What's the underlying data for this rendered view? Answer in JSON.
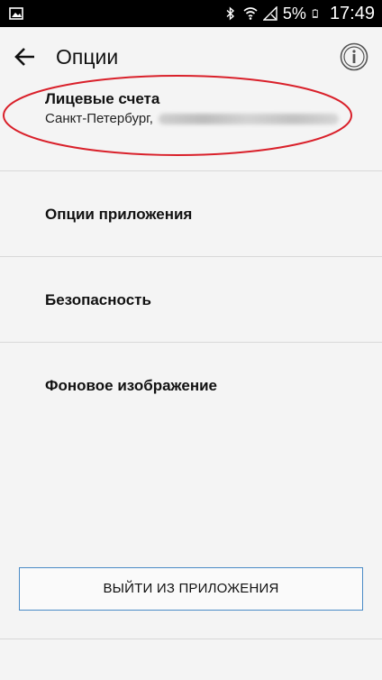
{
  "status_bar": {
    "left_icon": "image-notification-icon",
    "icons": [
      "bluetooth-icon",
      "wifi-icon",
      "no-signal-icon",
      "battery-icon"
    ],
    "battery": "5%",
    "time": "17:49"
  },
  "app_bar": {
    "title": "Опции",
    "back_icon": "arrow-back-icon",
    "info_icon": "info-icon"
  },
  "settings": {
    "items": [
      {
        "label": "Лицевые счета",
        "subtitle": "Санкт-Петербург,"
      },
      {
        "label": "Опции приложения"
      },
      {
        "label": "Безопасность"
      },
      {
        "label": "Фоновое изображение"
      }
    ]
  },
  "logout_button": {
    "label": "ВЫЙТИ ИЗ ПРИЛОЖЕНИЯ"
  },
  "annotation": {
    "color": "#d9202a"
  },
  "colors": {
    "button_border": "#4a8bc6",
    "divider": "#d8d8d8",
    "background": "#f4f4f4"
  }
}
